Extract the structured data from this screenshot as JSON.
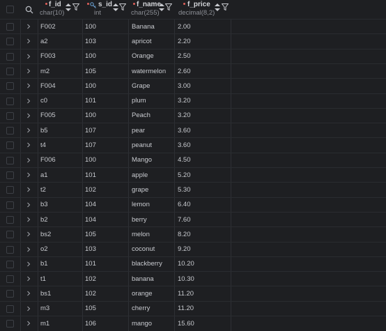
{
  "columns": [
    {
      "name": "f_id",
      "type": "char(10)",
      "required": true,
      "key": false
    },
    {
      "name": "s_id",
      "type": "int",
      "required": true,
      "key": true
    },
    {
      "name": "f_name",
      "type": "char(255)",
      "required": true,
      "key": false
    },
    {
      "name": "f_price",
      "type": "decimal(8,2)",
      "required": true,
      "key": false
    }
  ],
  "rows": [
    {
      "f_id": "F002",
      "s_id": "100",
      "f_name": "Banana",
      "f_price": "2.00"
    },
    {
      "f_id": "a2",
      "s_id": "103",
      "f_name": "apricot",
      "f_price": "2.20"
    },
    {
      "f_id": "F003",
      "s_id": "100",
      "f_name": "Orange",
      "f_price": "2.50"
    },
    {
      "f_id": "m2",
      "s_id": "105",
      "f_name": "watermelon",
      "f_price": "2.60"
    },
    {
      "f_id": "F004",
      "s_id": "100",
      "f_name": "Grape",
      "f_price": "3.00"
    },
    {
      "f_id": "c0",
      "s_id": "101",
      "f_name": "plum",
      "f_price": "3.20"
    },
    {
      "f_id": "F005",
      "s_id": "100",
      "f_name": "Peach",
      "f_price": "3.20"
    },
    {
      "f_id": "b5",
      "s_id": "107",
      "f_name": "pear",
      "f_price": "3.60"
    },
    {
      "f_id": "t4",
      "s_id": "107",
      "f_name": "peanut",
      "f_price": "3.60"
    },
    {
      "f_id": "F006",
      "s_id": "100",
      "f_name": "Mango",
      "f_price": "4.50"
    },
    {
      "f_id": "a1",
      "s_id": "101",
      "f_name": "apple",
      "f_price": "5.20"
    },
    {
      "f_id": "t2",
      "s_id": "102",
      "f_name": "grape",
      "f_price": "5.30"
    },
    {
      "f_id": "b3",
      "s_id": "104",
      "f_name": "lemon",
      "f_price": "6.40"
    },
    {
      "f_id": "b2",
      "s_id": "104",
      "f_name": "berry",
      "f_price": "7.60"
    },
    {
      "f_id": "bs2",
      "s_id": "105",
      "f_name": "melon",
      "f_price": "8.20"
    },
    {
      "f_id": "o2",
      "s_id": "103",
      "f_name": "coconut",
      "f_price": "9.20"
    },
    {
      "f_id": "b1",
      "s_id": "101",
      "f_name": "blackberry",
      "f_price": "10.20"
    },
    {
      "f_id": "t1",
      "s_id": "102",
      "f_name": "banana",
      "f_price": "10.30"
    },
    {
      "f_id": "bs1",
      "s_id": "102",
      "f_name": "orange",
      "f_price": "11.20"
    },
    {
      "f_id": "m3",
      "s_id": "105",
      "f_name": "cherry",
      "f_price": "11.20"
    },
    {
      "f_id": "m1",
      "s_id": "106",
      "f_name": "mango",
      "f_price": "15.60"
    }
  ],
  "colors": {
    "background": "#1e1f22",
    "text": "#c8cacf",
    "header_text": "#d4d6da",
    "type_text": "#8c8f96",
    "required_marker": "#e0605a",
    "key_icon": "#6fa8dc"
  }
}
